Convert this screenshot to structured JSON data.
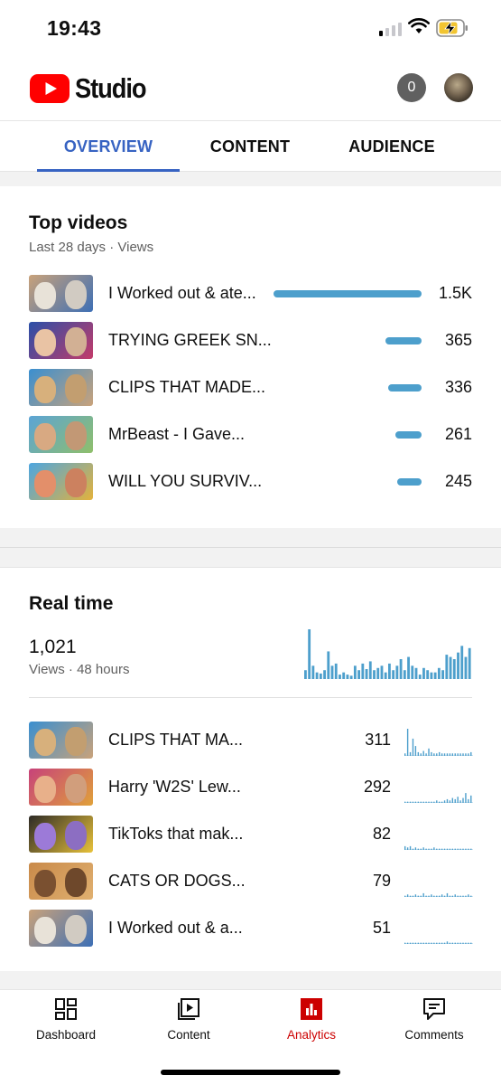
{
  "status_bar": {
    "time": "19:43"
  },
  "header": {
    "logo_text": "Studio",
    "notification_count": "0"
  },
  "tabs": [
    {
      "label": "OVERVIEW",
      "active": true
    },
    {
      "label": "CONTENT",
      "active": false
    },
    {
      "label": "AUDIENCE",
      "active": false
    }
  ],
  "top_videos": {
    "title": "Top videos",
    "subtitle": "Last 28 days · Views",
    "items": [
      {
        "title": "I Worked out & ate...",
        "views": "1.5K",
        "views_value": 1500,
        "thumb_colors": [
          "#c9a27a",
          "#3d6fb5",
          "#e8e2d8"
        ]
      },
      {
        "title": "TRYING GREEK SN...",
        "views": "365",
        "views_value": 365,
        "thumb_colors": [
          "#2a4fa8",
          "#c33b6a",
          "#e9c3a4"
        ]
      },
      {
        "title": "CLIPS THAT MADE...",
        "views": "336",
        "views_value": 336,
        "thumb_colors": [
          "#3a8fd0",
          "#c9a27a",
          "#d7b07c"
        ]
      },
      {
        "title": "MrBeast - I Gave...",
        "views": "261",
        "views_value": 261,
        "thumb_colors": [
          "#5ba4d6",
          "#8fbf6a",
          "#d8a982"
        ]
      },
      {
        "title": "WILL YOU SURVIV...",
        "views": "245",
        "views_value": 245,
        "thumb_colors": [
          "#4da6e0",
          "#e3b23c",
          "#e38f6a"
        ]
      }
    ]
  },
  "real_time": {
    "title": "Real time",
    "total": "1,021",
    "subtitle": "Views · 48 hours",
    "hourly_views": [
      8,
      45,
      12,
      6,
      5,
      8,
      25,
      12,
      14,
      4,
      6,
      4,
      3,
      12,
      8,
      14,
      9,
      16,
      8,
      10,
      12,
      6,
      14,
      8,
      12,
      18,
      8,
      20,
      12,
      10,
      4,
      10,
      8,
      6,
      6,
      10,
      8,
      22,
      20,
      18,
      24,
      30,
      20,
      28
    ],
    "items": [
      {
        "title": "CLIPS THAT MA...",
        "views": "311",
        "thumb_colors": [
          "#3a8fd0",
          "#c9a27a",
          "#d7b07c"
        ],
        "spark": [
          2,
          22,
          3,
          14,
          8,
          3,
          2,
          4,
          2,
          6,
          3,
          2,
          2,
          3,
          2,
          2,
          2,
          2,
          2,
          2,
          2,
          2,
          2,
          2,
          2,
          3
        ]
      },
      {
        "title": "Harry 'W2S' Lew...",
        "views": "292",
        "thumb_colors": [
          "#c7427a",
          "#e0a13a",
          "#e8b08a"
        ],
        "spark": [
          1,
          1,
          1,
          1,
          1,
          1,
          1,
          1,
          1,
          1,
          1,
          1,
          2,
          1,
          1,
          2,
          3,
          2,
          4,
          3,
          5,
          2,
          4,
          8,
          3,
          6
        ]
      },
      {
        "title": "TikToks that mak...",
        "views": "82",
        "thumb_colors": [
          "#2d2a26",
          "#e8c23a",
          "#9c7ad8"
        ],
        "spark": [
          3,
          2,
          3,
          1,
          2,
          1,
          1,
          2,
          1,
          1,
          1,
          2,
          1,
          1,
          1,
          1,
          1,
          1,
          1,
          1,
          1,
          1,
          1,
          1,
          1,
          1
        ]
      },
      {
        "title": "CATS OR DOGS...",
        "views": "79",
        "thumb_colors": [
          "#c98a4a",
          "#e0b070",
          "#7a5030"
        ],
        "spark": [
          1,
          2,
          1,
          1,
          2,
          1,
          1,
          3,
          1,
          1,
          2,
          1,
          1,
          1,
          2,
          1,
          3,
          1,
          1,
          2,
          1,
          1,
          1,
          1,
          2,
          1
        ]
      },
      {
        "title": "I Worked out & a...",
        "views": "51",
        "thumb_colors": [
          "#c9a27a",
          "#3d6fb5",
          "#e8e2d8"
        ],
        "spark": [
          1,
          1,
          1,
          1,
          1,
          1,
          1,
          1,
          1,
          1,
          1,
          1,
          1,
          1,
          1,
          1,
          2,
          1,
          1,
          1,
          1,
          1,
          1,
          1,
          1,
          1
        ]
      }
    ]
  },
  "bottom_nav": [
    {
      "label": "Dashboard",
      "icon": "dashboard-icon",
      "active": false
    },
    {
      "label": "Content",
      "icon": "content-icon",
      "active": false
    },
    {
      "label": "Analytics",
      "icon": "analytics-icon",
      "active": true
    },
    {
      "label": "Comments",
      "icon": "comments-icon",
      "active": false
    }
  ],
  "colors": {
    "accent_blue": "#3763c2",
    "bar_blue": "#4d9fcc",
    "analytics_red": "#cc0000",
    "youtube_red": "#ff0000"
  }
}
